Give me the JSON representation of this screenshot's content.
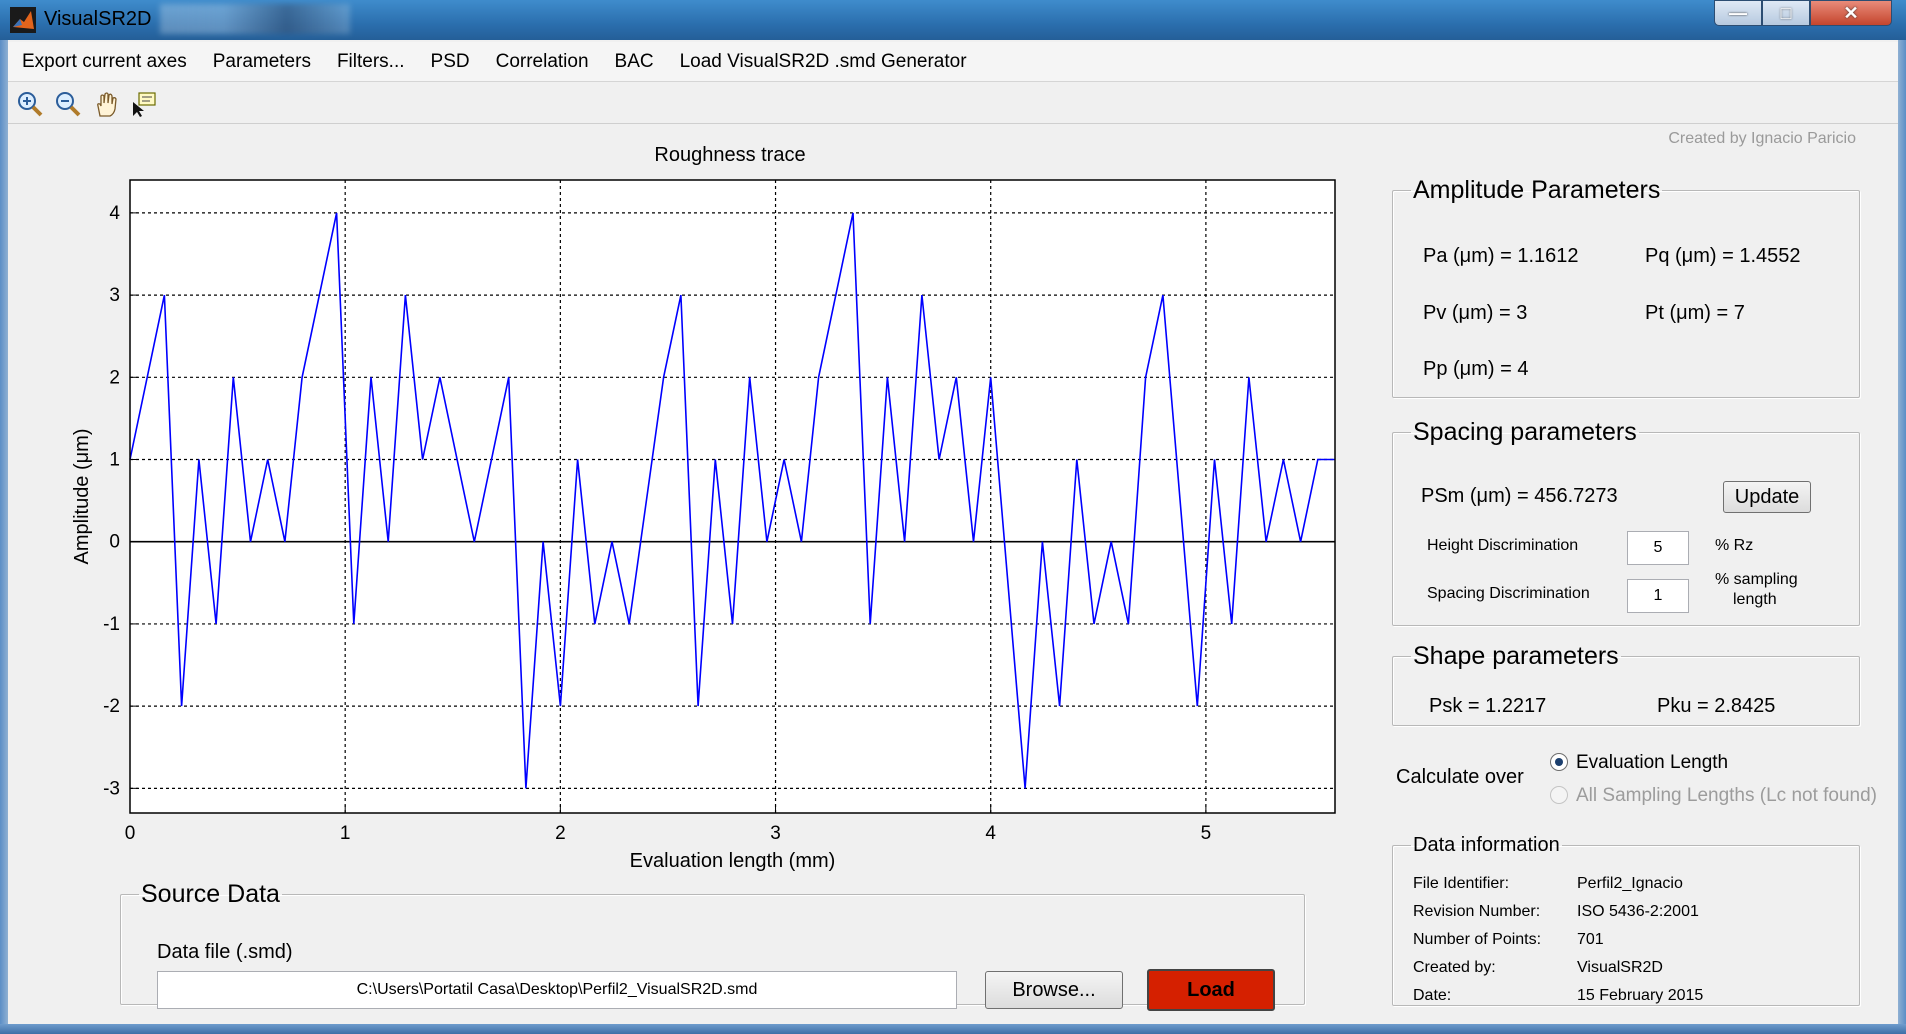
{
  "window": {
    "title": "VisualSR2D"
  },
  "menu": [
    "Export current axes",
    "Parameters",
    "Filters...",
    "PSD",
    "Correlation",
    "BAC",
    "Load VisualSR2D .smd Generator"
  ],
  "toolbar": [
    {
      "icon": "zoom-in-icon"
    },
    {
      "icon": "zoom-out-icon"
    },
    {
      "icon": "pan-hand-icon"
    },
    {
      "icon": "data-cursor-icon"
    }
  ],
  "credit": "Created by Ignacio Paricio",
  "chart_data": {
    "type": "line",
    "title": "Roughness trace",
    "xlabel": "Evaluation length (mm)",
    "ylabel": "Amplitude (μm)",
    "xlim": [
      0,
      5.6
    ],
    "ylim": [
      -3.3,
      4.4
    ],
    "xticks": [
      "0",
      "1",
      "2",
      "3",
      "4",
      "5"
    ],
    "yticks": [
      "4",
      "3",
      "2",
      "1",
      "0",
      "-1",
      "-2",
      "-3"
    ],
    "grid": true,
    "color": "#0000ff",
    "series": [
      {
        "x": [
          0,
          0.16,
          0.24,
          0.32,
          0.4,
          0.48,
          0.56,
          0.64,
          0.72,
          0.8,
          0.96,
          1.04,
          1.12,
          1.2,
          1.28,
          1.36,
          1.44,
          1.6,
          1.76,
          1.84,
          1.92,
          2.0,
          2.08,
          2.16,
          2.24,
          2.32,
          2.48,
          2.56,
          2.64,
          2.72,
          2.8,
          2.88,
          2.96,
          3.04,
          3.12,
          3.2,
          3.36,
          3.44,
          3.52,
          3.6,
          3.68,
          3.76,
          3.84,
          3.92,
          4.0,
          4.16,
          4.24,
          4.32,
          4.4,
          4.48,
          4.56,
          4.64,
          4.72,
          4.8,
          4.96,
          5.04,
          5.12,
          5.2,
          5.28,
          5.36,
          5.44,
          5.52,
          5.6
        ],
        "y": [
          1,
          3,
          -2,
          1,
          -1,
          2,
          0,
          1,
          0,
          2,
          4,
          -1,
          2,
          0,
          3,
          1,
          2,
          0,
          2,
          -3,
          0,
          -2,
          1,
          -1,
          0,
          -1,
          2,
          3,
          -2,
          1,
          -1,
          2,
          0,
          1,
          0,
          2,
          4,
          -1,
          2,
          0,
          3,
          1,
          2,
          0,
          2,
          -3,
          0,
          -2,
          1,
          -1,
          0,
          -1,
          2,
          3,
          -2,
          1,
          -1,
          2,
          0,
          1,
          0,
          1,
          1
        ]
      }
    ]
  },
  "amplitude": {
    "legend": "Amplitude Parameters",
    "pa": "Pa  (μm) = 1.1612",
    "pq": "Pq  (μm) = 1.4552",
    "pv": "Pv  (μm) = 3",
    "pt": "Pt  (μm) = 7",
    "pp": "Pp  (μm) = 4"
  },
  "spacing": {
    "legend": "Spacing parameters",
    "psm": "PSm (μm)  = 456.7273",
    "update_label": "Update",
    "height_disc_label": "Height Discrimination",
    "height_disc_value": "5",
    "height_disc_unit": "% Rz",
    "spacing_disc_label": "Spacing Discrimination",
    "spacing_disc_value": "1",
    "spacing_disc_unit_1": "% sampling",
    "spacing_disc_unit_2": "length"
  },
  "shape": {
    "legend": "Shape parameters",
    "psk": "Psk = 1.2217",
    "pku": "Pku = 2.8425"
  },
  "calc": {
    "label": "Calculate over",
    "option1": "Evaluation Length",
    "option2": "All Sampling Lengths (Lc not found)"
  },
  "datainfo": {
    "legend": "Data information",
    "rows": [
      {
        "key": "File Identifier:",
        "value": "Perfil2_Ignacio"
      },
      {
        "key": "Revision Number:",
        "value": "ISO 5436-2:2001"
      },
      {
        "key": "Number of Points:",
        "value": "701"
      },
      {
        "key": "Created by:",
        "value": "VisualSR2D"
      },
      {
        "key": "Date:",
        "value": "15 February 2015"
      }
    ]
  },
  "source": {
    "legend": "Source Data",
    "file_label": "Data file (.smd)",
    "path": "C:\\Users\\Portatil Casa\\Desktop\\Perfil2_VisualSR2D.smd",
    "browse_label": "Browse...",
    "load_label": "Load"
  }
}
